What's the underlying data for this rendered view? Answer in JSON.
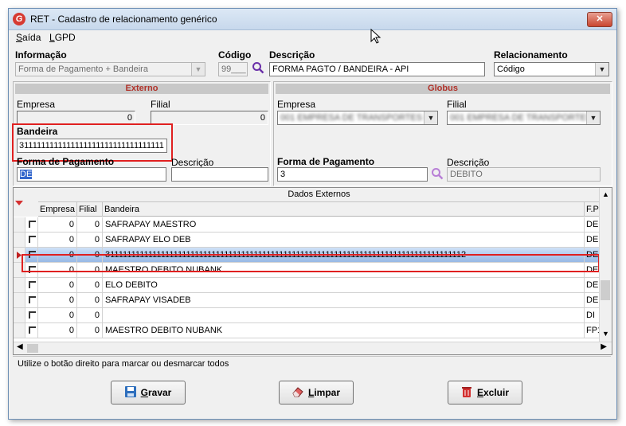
{
  "window": {
    "title": "RET - Cadastro de relacionamento genérico",
    "close_label": "✕",
    "app_icon_letter": "G"
  },
  "menu": [
    {
      "key": "S",
      "rest": "aída"
    },
    {
      "key": "L",
      "rest": "GPD"
    }
  ],
  "top": {
    "informacao_label": "Informação",
    "informacao_value": "Forma de Pagamento + Bandeira",
    "codigo_label": "Código",
    "codigo_value": "99___",
    "descricao_label": "Descrição",
    "descricao_value": "FORMA PAGTO / BANDEIRA - API",
    "relacionamento_label": "Relacionamento",
    "relacionamento_value": "Código"
  },
  "externo": {
    "header": "Externo",
    "empresa_label": "Empresa",
    "empresa_value": "0",
    "filial_label": "Filial",
    "filial_value": "0",
    "bandeira_label": "Bandeira",
    "bandeira_value": "3111111111111111111111111111111111",
    "forma_pagamento_label": "Forma de Pagamento",
    "forma_pagamento_value": "DE",
    "descricao_label": "Descrição",
    "descricao_value": ""
  },
  "globus": {
    "header": "Globus",
    "empresa_label": "Empresa",
    "empresa_value": "001 EMPRESA DE TRANSPORTES LTDA",
    "filial_label": "Filial",
    "filial_value": "001 EMPRESA DE TRANSPORTES LTDA",
    "forma_pagamento_label": "Forma de Pagamento",
    "forma_pagamento_value": "3",
    "descricao_label": "Descrição",
    "descricao_value": "DEBITO"
  },
  "grid": {
    "caption": "Dados Externos",
    "columns": [
      "Empresa",
      "Filial",
      "Bandeira",
      "F.P"
    ],
    "rows": [
      {
        "empresa": "0",
        "filial": "0",
        "bandeira": "SAFRAPAY MAESTRO",
        "fp": "DE"
      },
      {
        "empresa": "0",
        "filial": "0",
        "bandeira": "SAFRAPAY ELO DEB",
        "fp": "DE"
      },
      {
        "empresa": "0",
        "filial": "0",
        "bandeira": "3111111111111111111111111111111111111111111111111111111111111111111111111111111111112",
        "fp": "DE"
      },
      {
        "empresa": "0",
        "filial": "0",
        "bandeira": "MAESTRO DEBITO NUBANK",
        "fp": "DE"
      },
      {
        "empresa": "0",
        "filial": "0",
        "bandeira": "ELO DEBITO",
        "fp": "DE"
      },
      {
        "empresa": "0",
        "filial": "0",
        "bandeira": "SAFRAPAY VISADEB",
        "fp": "DE"
      },
      {
        "empresa": "0",
        "filial": "0",
        "bandeira": "",
        "fp": "DI"
      },
      {
        "empresa": "0",
        "filial": "0",
        "bandeira": "MAESTRO DEBITO NUBANK",
        "fp": "FP1"
      }
    ],
    "selected_row": 2
  },
  "status_text": "Utilize o botão direito para marcar ou desmarcar todos",
  "buttons": {
    "gravar": {
      "key": "G",
      "rest": "ravar"
    },
    "limpar": {
      "key": "L",
      "rest": "impar"
    },
    "excluir": {
      "key": "E",
      "rest": "xcluir"
    }
  },
  "colors": {
    "highlight_box": "#e02020",
    "group_header_text": "#b0322a",
    "selected_row": "#97b9e5"
  }
}
